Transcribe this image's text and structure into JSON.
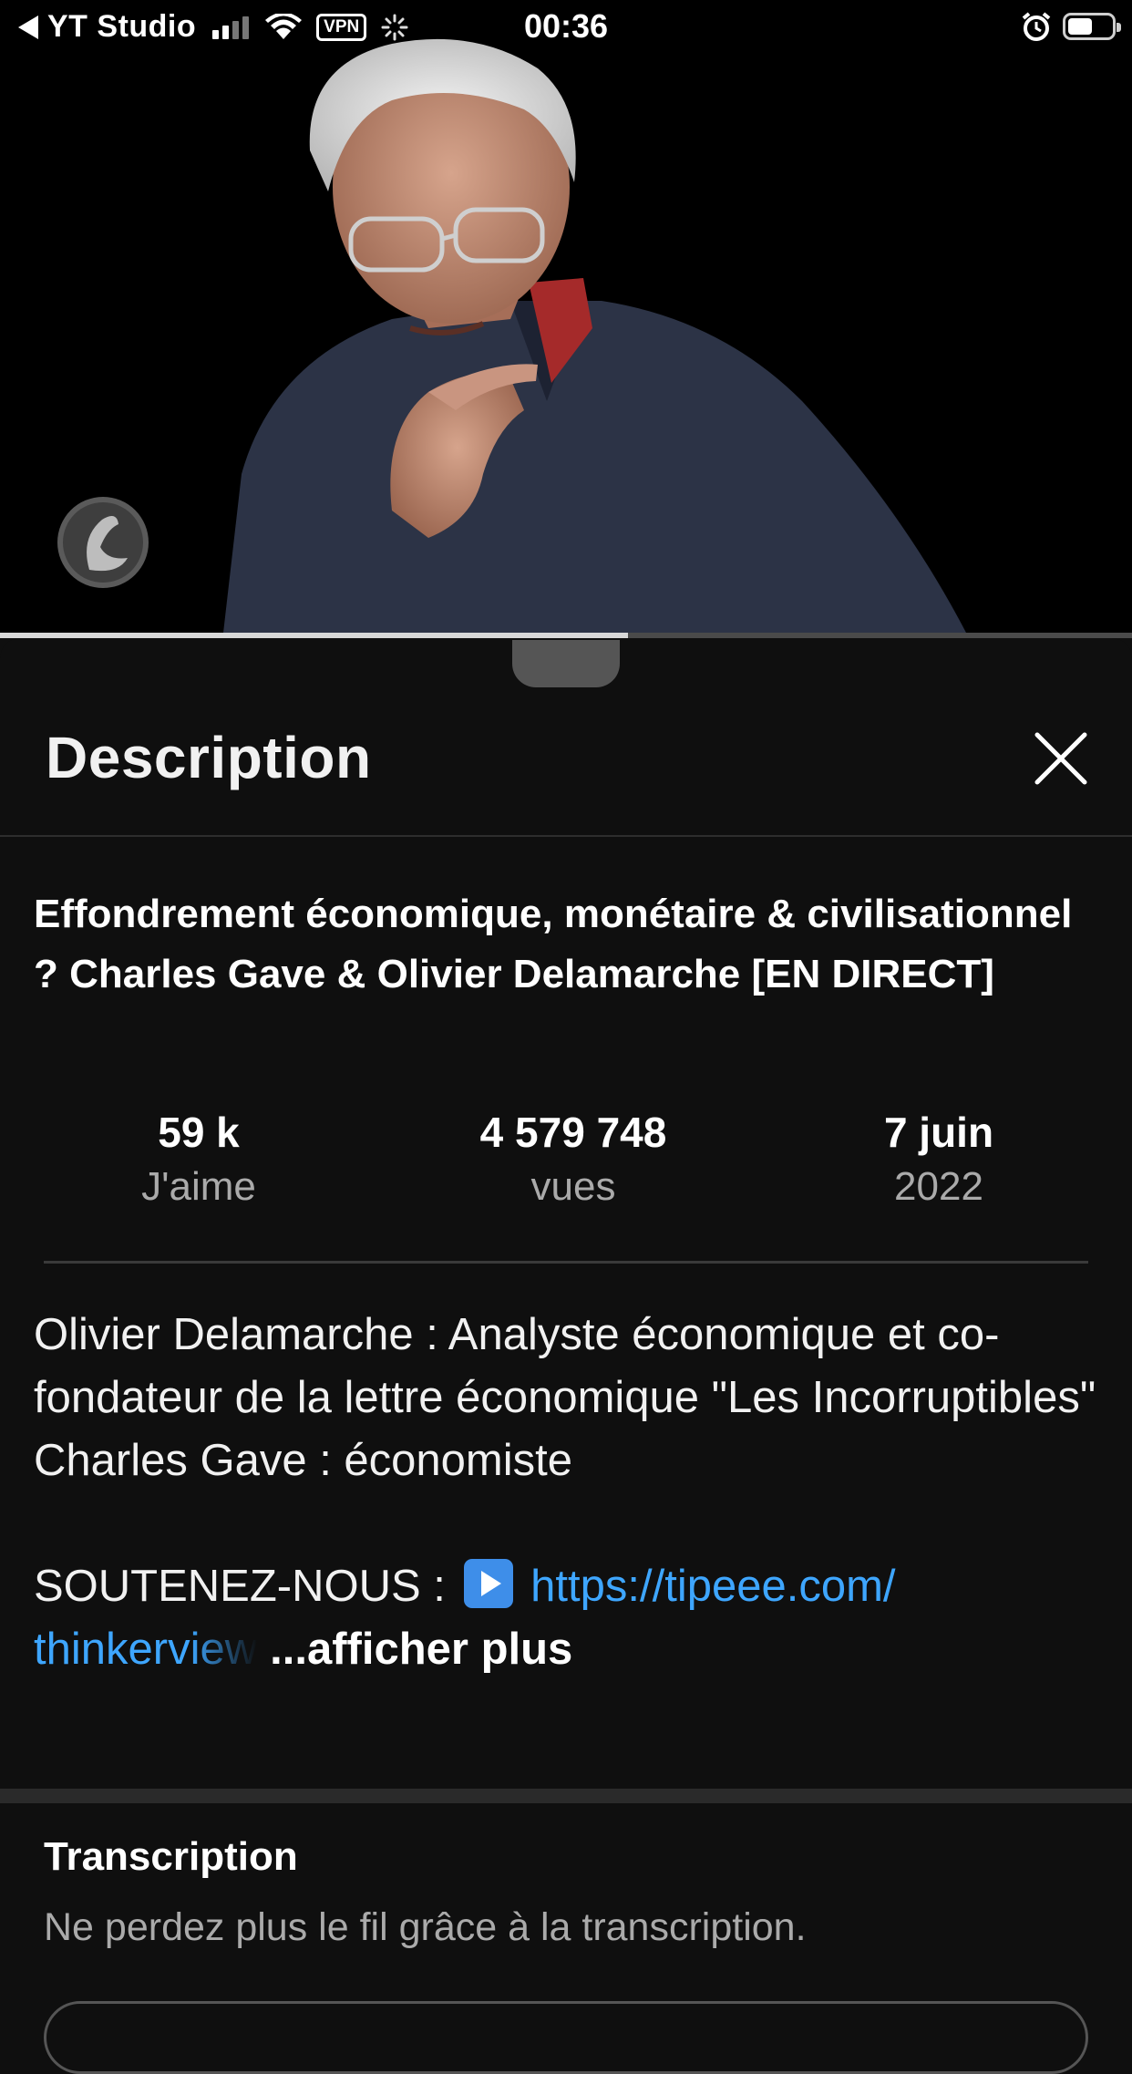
{
  "status_bar": {
    "back_app": "YT Studio",
    "vpn": "VPN",
    "time": "00:36",
    "signal_bars_active": 2,
    "battery_level": 0.55,
    "icons": [
      "back-arrow-icon",
      "cellular-signal-icon",
      "wifi-icon",
      "vpn-icon",
      "loading-spinner-icon",
      "alarm-icon",
      "battery-icon"
    ]
  },
  "player": {
    "progress": 0.555
  },
  "sheet": {
    "title": "Description",
    "close_icon": "close-icon"
  },
  "video": {
    "title": "Effondrement économique, monétaire & civilisationnel ? Charles Gave & Olivier Delamarche [EN DIRECT]",
    "stats": [
      {
        "value": "59 k",
        "label": "J'aime"
      },
      {
        "value": "4 579 748",
        "label": "vues"
      },
      {
        "value": "7 juin",
        "label": "2022"
      }
    ]
  },
  "description": {
    "line1": "Olivier Delamarche :  Analyste économique et co-fondateur de la lettre économique \"Les Incorruptibles\"",
    "line2": "Charles Gave : économiste",
    "support_label": "SOUTENEZ-NOUS : ",
    "support_icon": "play-button-emoji",
    "link_part1": "https://tipeee.com/",
    "link_part2": "thinkerview",
    "show_more": "...afficher plus"
  },
  "transcript": {
    "title": "Transcription",
    "subtitle": "Ne perdez plus le fil grâce à la transcription."
  },
  "colors": {
    "background": "#0f0f0f",
    "link": "#3ea6ff",
    "secondary_text": "#aaaaaa"
  }
}
